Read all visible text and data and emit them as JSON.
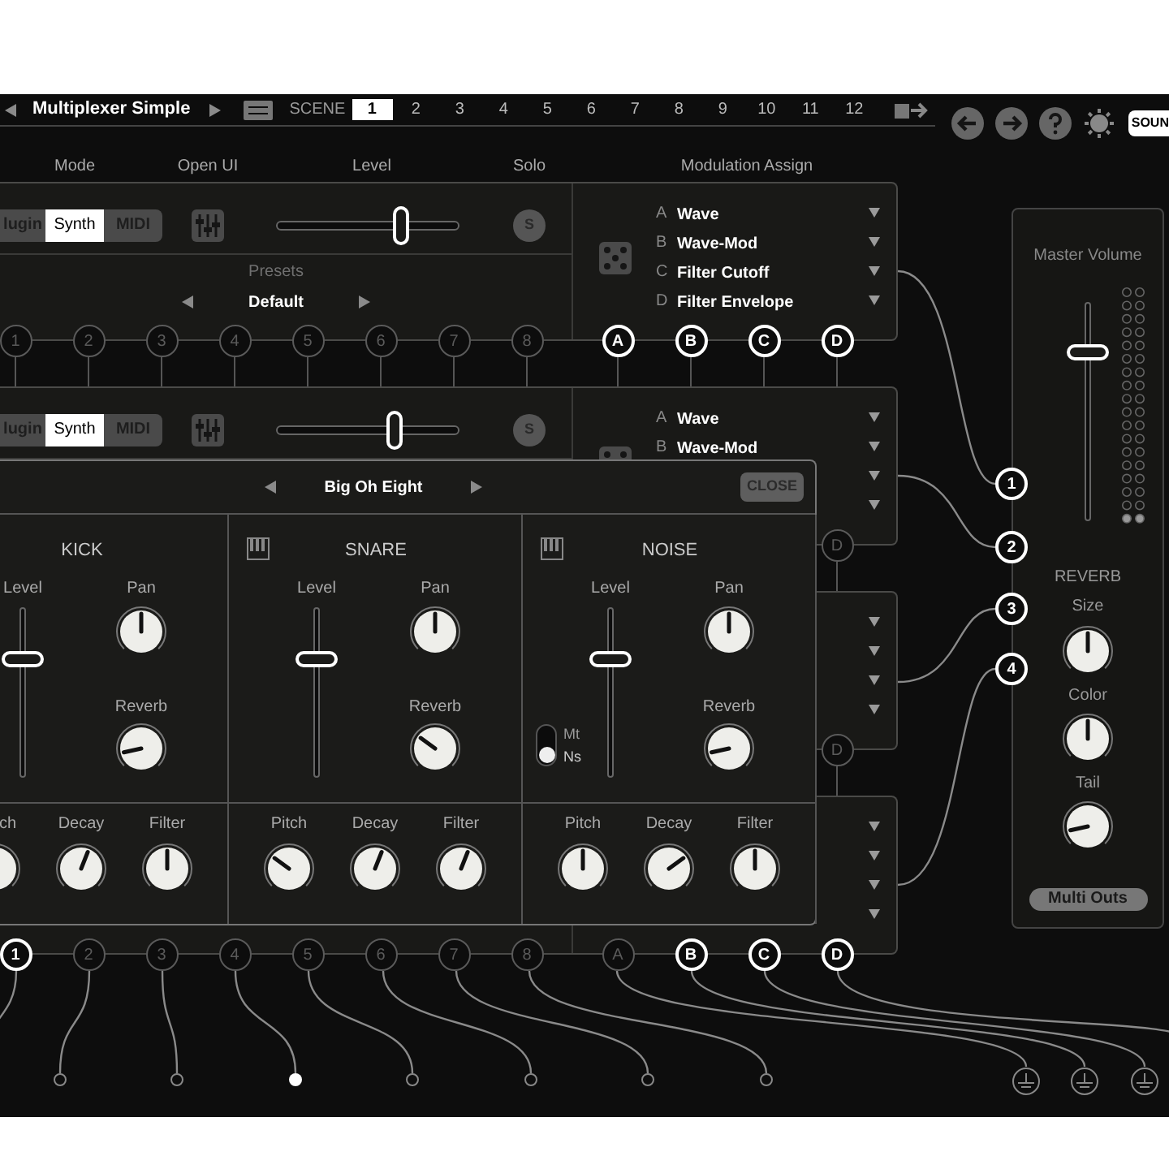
{
  "header": {
    "title": "Multiplexer Simple",
    "scene_label": "SCENE",
    "scenes": [
      {
        "label": "1",
        "selected": true
      },
      {
        "label": "2",
        "selected": false
      },
      {
        "label": "3",
        "selected": false
      },
      {
        "label": "4",
        "selected": false
      },
      {
        "label": "5",
        "selected": false
      },
      {
        "label": "6",
        "selected": false
      },
      {
        "label": "7",
        "selected": false
      },
      {
        "label": "8",
        "selected": false
      },
      {
        "label": "9",
        "selected": false
      },
      {
        "label": "10",
        "selected": false
      },
      {
        "label": "11",
        "selected": false
      },
      {
        "label": "12",
        "selected": false
      }
    ]
  },
  "toolbar_button": "SOUN",
  "column_headers": [
    "Mode",
    "Open UI",
    "Level",
    "Solo",
    "Modulation Assign"
  ],
  "strips": [
    {
      "modes": [
        {
          "label": "lugin",
          "selected": false
        },
        {
          "label": "Synth",
          "selected": true
        },
        {
          "label": "MIDI",
          "selected": false
        }
      ],
      "level": 0.68,
      "solo": "S",
      "preset_label": "Presets",
      "preset": "Default",
      "assignments": [
        {
          "letter": "A",
          "name": "Wave"
        },
        {
          "letter": "B",
          "name": "Wave-Mod"
        },
        {
          "letter": "C",
          "name": "Filter Cutoff"
        },
        {
          "letter": "D",
          "name": "Filter Envelope"
        }
      ],
      "inputs": [
        {
          "label": "1",
          "active": false
        },
        {
          "label": "2",
          "active": false
        },
        {
          "label": "3",
          "active": false
        },
        {
          "label": "4",
          "active": false
        },
        {
          "label": "5",
          "active": false
        },
        {
          "label": "6",
          "active": false
        },
        {
          "label": "7",
          "active": false
        },
        {
          "label": "8",
          "active": false
        }
      ],
      "mod_ports": [
        {
          "label": "A",
          "active": true
        },
        {
          "label": "B",
          "active": true
        },
        {
          "label": "C",
          "active": true
        },
        {
          "label": "D",
          "active": true
        }
      ]
    },
    {
      "modes": [
        {
          "label": "lugin",
          "selected": false
        },
        {
          "label": "Synth",
          "selected": true
        },
        {
          "label": "MIDI",
          "selected": false
        }
      ],
      "level": 0.65,
      "solo": "S",
      "assignments": [
        {
          "letter": "A",
          "name": "Wave"
        },
        {
          "letter": "B",
          "name": "Wave-Mod"
        }
      ],
      "mod_ports": [
        {
          "label": "D",
          "active": false
        }
      ]
    },
    {
      "mod_ports": [
        {
          "label": "D",
          "active": false
        }
      ]
    },
    {
      "inputs": [
        {
          "label": "1",
          "active": true
        },
        {
          "label": "2",
          "active": false
        },
        {
          "label": "3",
          "active": false
        },
        {
          "label": "4",
          "active": false
        },
        {
          "label": "5",
          "active": false
        },
        {
          "label": "6",
          "active": false
        },
        {
          "label": "7",
          "active": false
        },
        {
          "label": "8",
          "active": false
        }
      ],
      "mod_ports": [
        {
          "label": "A",
          "active": false
        },
        {
          "label": "B",
          "active": true
        },
        {
          "label": "C",
          "active": true
        },
        {
          "label": "D",
          "active": true
        }
      ]
    }
  ],
  "drum_panel": {
    "title": "Big Oh Eight",
    "close": "CLOSE",
    "voices": [
      {
        "name": "KICK",
        "kind": "cut",
        "fader": {
          "label": "Level",
          "level": 0.7
        },
        "top_knobs": [
          {
            "label": "Pan"
          },
          {
            "label": "Reverb"
          }
        ],
        "bottom_knobs": [
          {
            "label": "ch",
            "kind": "cut"
          },
          {
            "label": "Decay",
            "kind": "full"
          },
          {
            "label": "Filter",
            "kind": "full"
          }
        ]
      },
      {
        "name": "SNARE",
        "kind": "full",
        "fader": {
          "label": "Level",
          "level": 0.7
        },
        "top_knobs": [
          {
            "label": "Pan"
          },
          {
            "label": "Reverb"
          }
        ],
        "bottom_knobs": [
          {
            "label": "Pitch",
            "kind": "full"
          },
          {
            "label": "Decay",
            "kind": "full"
          },
          {
            "label": "Filter",
            "kind": "full"
          }
        ]
      },
      {
        "name": "NOISE",
        "kind": "full",
        "fader": {
          "label": "Level",
          "level": 0.7
        },
        "top_knobs": [
          {
            "label": "Pan"
          },
          {
            "label": "Reverb"
          }
        ],
        "bottom_knobs": [
          {
            "label": "Pitch",
            "kind": "full"
          },
          {
            "label": "Decay",
            "kind": "full"
          },
          {
            "label": "Filter",
            "kind": "full"
          }
        ],
        "toggle": {
          "options": [
            {
              "label": "Mt",
              "selected": false
            },
            {
              "label": "Ns",
              "selected": true
            }
          ]
        }
      }
    ]
  },
  "master": {
    "title": "Master Volume",
    "level": 0.77,
    "inputs": [
      "1",
      "2",
      "3",
      "4"
    ],
    "reverb_title": "REVERB",
    "knobs": [
      {
        "label": "Size"
      },
      {
        "label": "Color"
      },
      {
        "label": "Tail"
      }
    ],
    "button": "Multi Outs"
  },
  "outputs": [
    {
      "on": false
    },
    {
      "on": false
    },
    {
      "on": true
    },
    {
      "on": false
    },
    {
      "on": false
    },
    {
      "on": false
    },
    {
      "on": false
    }
  ]
}
